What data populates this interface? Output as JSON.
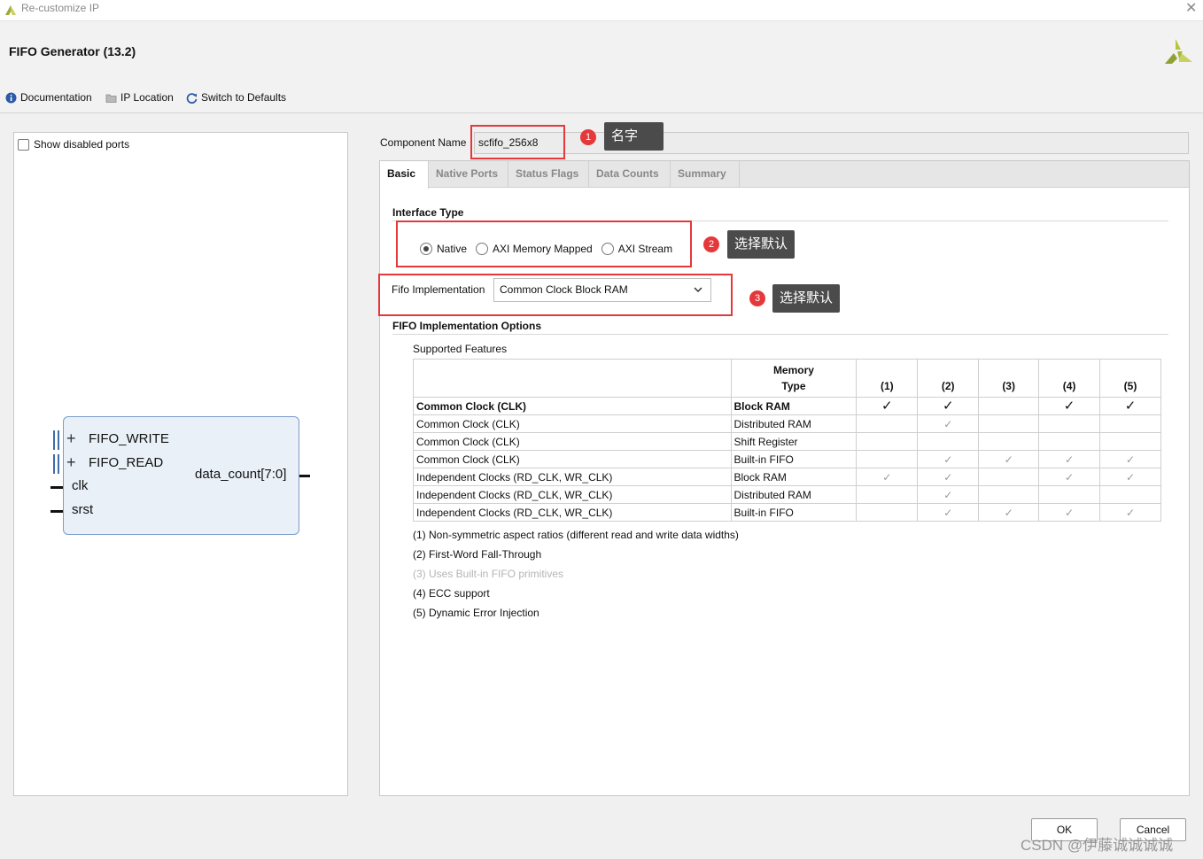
{
  "window": {
    "title": "Re-customize IP"
  },
  "header": {
    "ip_title": "FIFO Generator (13.2)"
  },
  "toolbar": {
    "documentation": "Documentation",
    "ip_location": "IP Location",
    "switch_defaults": "Switch to Defaults"
  },
  "left_panel": {
    "show_disabled_ports": "Show disabled ports",
    "symbol": {
      "ports_left": [
        "FIFO_WRITE",
        "FIFO_READ",
        "clk",
        "srst"
      ],
      "port_right": "data_count[7:0]"
    }
  },
  "component": {
    "label": "Component Name",
    "value": "scfifo_256x8"
  },
  "tabs": [
    "Basic",
    "Native Ports",
    "Status Flags",
    "Data Counts",
    "Summary"
  ],
  "basic": {
    "interface_type_title": "Interface Type",
    "radios": [
      "Native",
      "AXI Memory Mapped",
      "AXI Stream"
    ],
    "selected_radio": "Native",
    "fifo_impl_label": "Fifo Implementation",
    "fifo_impl_value": "Common Clock Block RAM",
    "options_title": "FIFO Implementation Options",
    "supported_features": "Supported Features",
    "table": {
      "header_memory_line1": "Memory",
      "header_memory_line2": "Type",
      "feature_headers": [
        "(1)",
        "(2)",
        "(3)",
        "(4)",
        "(5)"
      ],
      "rows": [
        {
          "clock": "Common Clock (CLK)",
          "memory": "Block RAM",
          "marks": [
            true,
            true,
            false,
            true,
            true
          ],
          "selected": true
        },
        {
          "clock": "Common Clock (CLK)",
          "memory": "Distributed RAM",
          "marks": [
            false,
            true,
            false,
            false,
            false
          ],
          "selected": false
        },
        {
          "clock": "Common Clock (CLK)",
          "memory": "Shift Register",
          "marks": [
            false,
            false,
            false,
            false,
            false
          ],
          "selected": false
        },
        {
          "clock": "Common Clock (CLK)",
          "memory": "Built-in FIFO",
          "marks": [
            false,
            true,
            true,
            true,
            true
          ],
          "selected": false
        },
        {
          "clock": "Independent Clocks (RD_CLK, WR_CLK)",
          "memory": "Block RAM",
          "marks": [
            true,
            true,
            false,
            true,
            true
          ],
          "selected": false
        },
        {
          "clock": "Independent Clocks (RD_CLK, WR_CLK)",
          "memory": "Distributed RAM",
          "marks": [
            false,
            true,
            false,
            false,
            false
          ],
          "selected": false
        },
        {
          "clock": "Independent Clocks (RD_CLK, WR_CLK)",
          "memory": "Built-in FIFO",
          "marks": [
            false,
            true,
            true,
            true,
            true
          ],
          "selected": false
        }
      ],
      "tick_glyph": "✓"
    },
    "notes": [
      {
        "text": "(1) Non-symmetric aspect ratios (different read and write data widths)",
        "dim": false
      },
      {
        "text": "(2) First-Word Fall-Through",
        "dim": false
      },
      {
        "text": "(3) Uses Built-in FIFO primitives",
        "dim": true
      },
      {
        "text": "(4) ECC support",
        "dim": false
      },
      {
        "text": "(5) Dynamic Error Injection",
        "dim": false
      }
    ]
  },
  "annotations": [
    {
      "number": "1",
      "text": "名字"
    },
    {
      "number": "2",
      "text": "选择默认"
    },
    {
      "number": "3",
      "text": "选择默认"
    }
  ],
  "buttons": {
    "ok": "OK",
    "cancel": "Cancel"
  },
  "watermark": "CSDN @伊藤诚诚诚诚",
  "colors": {
    "annotation_red": "#e5383b",
    "callout_bg": "#4b4b4b",
    "block_fill": "#e9f0f7",
    "block_border": "#7a9ccb"
  }
}
